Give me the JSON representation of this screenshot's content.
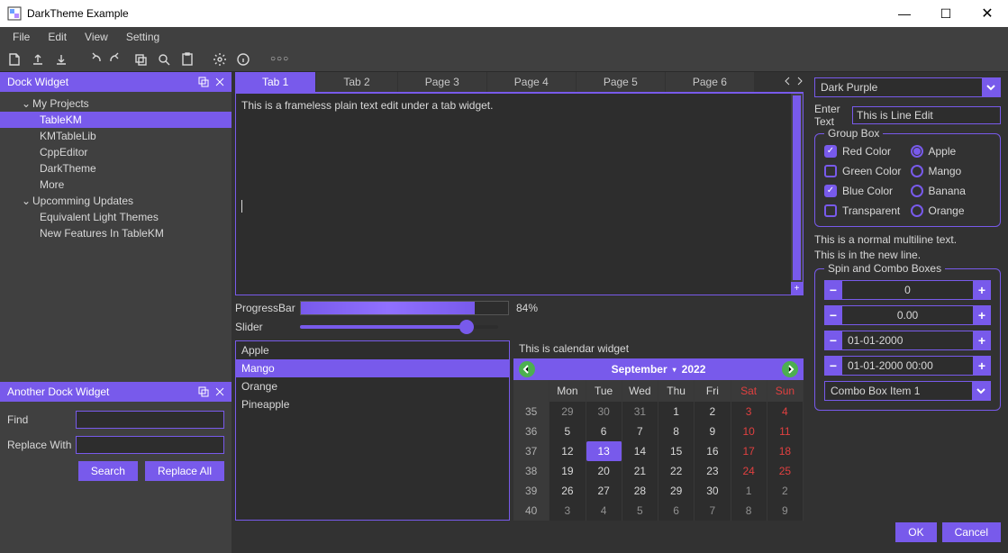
{
  "window_title": "DarkTheme Example",
  "menubar": [
    "File",
    "Edit",
    "View",
    "Setting"
  ],
  "dock1": {
    "title": "Dock Widget",
    "tree": {
      "root1": "My Projects",
      "root1_items": [
        "TableKM",
        "KMTableLib",
        "CppEditor",
        "DarkTheme",
        "More"
      ],
      "root2": "Upcomming Updates",
      "root2_items": [
        "Equivalent Light Themes",
        "New Features In TableKM"
      ],
      "selected": "TableKM"
    }
  },
  "dock2": {
    "title": "Another Dock Widget",
    "find_label": "Find",
    "replace_label": "Replace With",
    "find_value": "",
    "replace_value": "",
    "search_btn": "Search",
    "replace_all_btn": "Replace All"
  },
  "tabs": [
    "Tab 1",
    "Tab 2",
    "Page 3",
    "Page 4",
    "Page 5",
    "Page 6"
  ],
  "active_tab": 0,
  "textarea_content": "This is a frameless plain text edit under a tab widget.",
  "progress": {
    "label": "ProgressBar",
    "value": 84,
    "pct_text": "84%"
  },
  "slider": {
    "label": "Slider",
    "value": 84
  },
  "listbox": {
    "items": [
      "Apple",
      "Mango",
      "Orange",
      "Pineapple"
    ],
    "selected": "Mango"
  },
  "calendar": {
    "title": "This is  calendar widget",
    "month": "September",
    "year": "2022",
    "dow": [
      "Mon",
      "Tue",
      "Wed",
      "Thu",
      "Fri",
      "Sat",
      "Sun"
    ],
    "weeks": [
      {
        "wk": 35,
        "days": [
          {
            "d": 29,
            "o": true
          },
          {
            "d": 30,
            "o": true
          },
          {
            "d": 31,
            "o": true
          },
          {
            "d": 1
          },
          {
            "d": 2
          },
          {
            "d": 3,
            "we": true
          },
          {
            "d": 4,
            "we": true
          }
        ]
      },
      {
        "wk": 36,
        "days": [
          {
            "d": 5
          },
          {
            "d": 6
          },
          {
            "d": 7
          },
          {
            "d": 8
          },
          {
            "d": 9
          },
          {
            "d": 10,
            "we": true
          },
          {
            "d": 11,
            "we": true
          }
        ]
      },
      {
        "wk": 37,
        "days": [
          {
            "d": 12
          },
          {
            "d": 13,
            "today": true
          },
          {
            "d": 14
          },
          {
            "d": 15
          },
          {
            "d": 16
          },
          {
            "d": 17,
            "we": true
          },
          {
            "d": 18,
            "we": true
          }
        ]
      },
      {
        "wk": 38,
        "days": [
          {
            "d": 19
          },
          {
            "d": 20
          },
          {
            "d": 21
          },
          {
            "d": 22
          },
          {
            "d": 23
          },
          {
            "d": 24,
            "we": true
          },
          {
            "d": 25,
            "we": true
          }
        ]
      },
      {
        "wk": 39,
        "days": [
          {
            "d": 26
          },
          {
            "d": 27
          },
          {
            "d": 28
          },
          {
            "d": 29
          },
          {
            "d": 30
          },
          {
            "d": 1,
            "o": true
          },
          {
            "d": 2,
            "o": true
          }
        ]
      },
      {
        "wk": 40,
        "days": [
          {
            "d": 3,
            "o": true
          },
          {
            "d": 4,
            "o": true
          },
          {
            "d": 5,
            "o": true
          },
          {
            "d": 6,
            "o": true
          },
          {
            "d": 7,
            "o": true
          },
          {
            "d": 8,
            "o": true
          },
          {
            "d": 9,
            "o": true
          }
        ]
      }
    ]
  },
  "right": {
    "combo_top": "Dark Purple",
    "enter_text_label": "Enter Text",
    "enter_text_value": "This is Line Edit",
    "groupbox_title": "Group Box",
    "checks": [
      {
        "label": "Red Color",
        "on": true
      },
      {
        "label": "Green Color",
        "on": false
      },
      {
        "label": "Blue Color",
        "on": true
      },
      {
        "label": "Transparent",
        "on": false
      }
    ],
    "radios": [
      {
        "label": "Apple",
        "on": true
      },
      {
        "label": "Mango",
        "on": false
      },
      {
        "label": "Banana",
        "on": false
      },
      {
        "label": "Orange",
        "on": false
      }
    ],
    "multiline": [
      "This is a normal multiline text.",
      "This is in the new line."
    ],
    "spinbox_title": "Spin and Combo Boxes",
    "spin_int": "0",
    "spin_double": "0.00",
    "spin_date": "01-01-2000",
    "spin_datetime": "01-01-2000 00:00",
    "combo_item": "Combo Box Item 1",
    "ok": "OK",
    "cancel": "Cancel"
  },
  "colors": {
    "accent": "#785aeb",
    "bg": "#323232",
    "panel": "#404040",
    "input": "#2d2d2d"
  }
}
